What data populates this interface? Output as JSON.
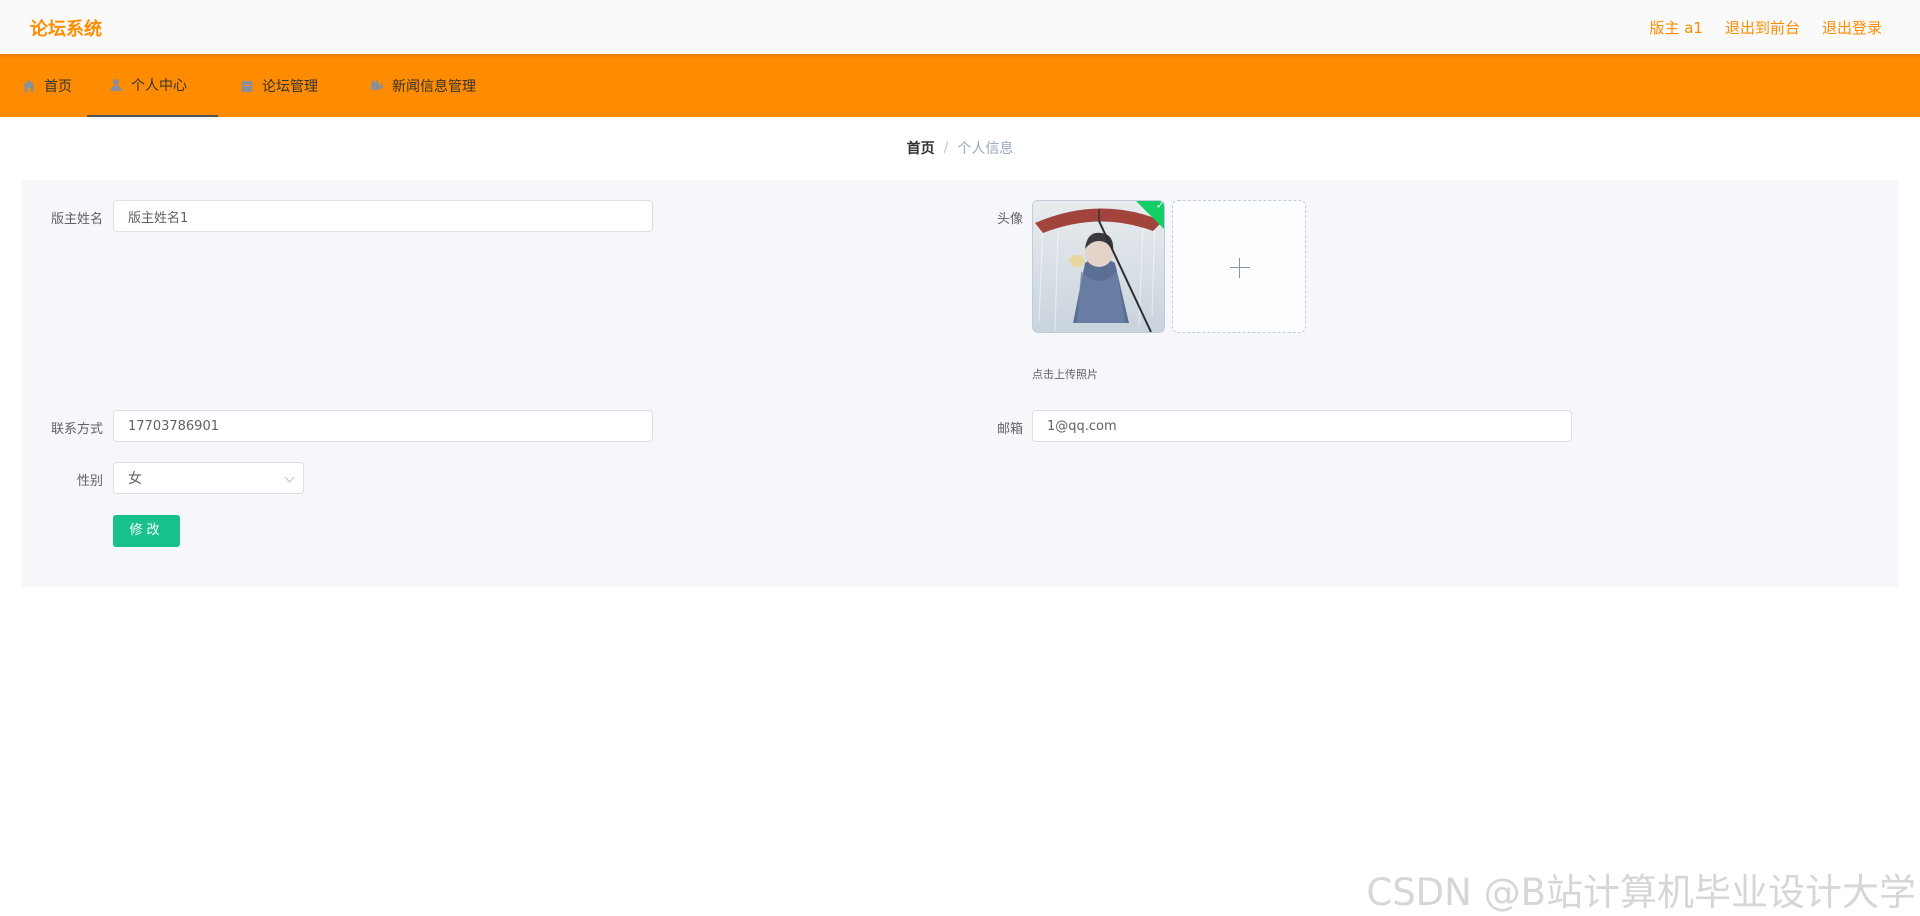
{
  "header": {
    "brand": "论坛系统",
    "actions": [
      "版主 a1",
      "退出到前台",
      "退出登录"
    ]
  },
  "nav": {
    "items": [
      {
        "label": "首页",
        "icon": "home-icon"
      },
      {
        "label": "个人中心",
        "icon": "user-icon"
      },
      {
        "label": "论坛管理",
        "icon": "calendar-icon"
      },
      {
        "label": "新闻信息管理",
        "icon": "video-camera-icon"
      }
    ],
    "active_index": 1
  },
  "breadcrumb": {
    "home": "首页",
    "separator": "/",
    "current": "个人信息"
  },
  "form": {
    "name_label": "版主姓名",
    "name_value": "版主姓名1",
    "avatar_label": "头像",
    "avatar_upload_tip": "点击上传照片",
    "phone_label": "联系方式",
    "phone_value": "17703786901",
    "email_label": "邮箱",
    "email_value": "1@qq.com",
    "gender_label": "性别",
    "gender_value": "女",
    "submit_label": "修改"
  },
  "watermark": "CSDN @B站计算机毕业设计大学",
  "colors": {
    "accent": "#ff8c00",
    "submit": "#19c28d",
    "avatar_success": "#13ce66"
  }
}
